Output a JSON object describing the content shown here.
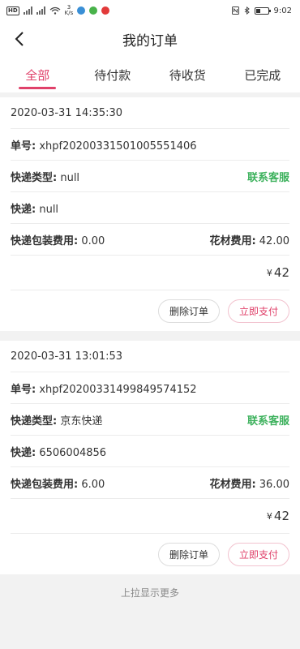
{
  "status_bar": {
    "network_badge": "HD",
    "speed_value": "3",
    "speed_unit": "K/s",
    "time": "9:02"
  },
  "header": {
    "title": "我的订单"
  },
  "tabs": [
    {
      "label": "全部",
      "active": true
    },
    {
      "label": "待付款",
      "active": false
    },
    {
      "label": "待收货",
      "active": false
    },
    {
      "label": "已完成",
      "active": false
    }
  ],
  "labels": {
    "order_no": "单号:",
    "express_type": "快递类型:",
    "express": "快递:",
    "pack_fee": "快递包装费用:",
    "flower_fee": "花材费用:",
    "contact_service": "联系客服",
    "currency": "¥",
    "delete_order": "删除订单",
    "pay_now": "立即支付"
  },
  "orders": [
    {
      "datetime": "2020-03-31 14:35:30",
      "order_no": "xhpf20200331501005551406",
      "express_type": "null",
      "express": "null",
      "pack_fee": "0.00",
      "flower_fee": "42.00",
      "total": "42"
    },
    {
      "datetime": "2020-03-31 13:01:53",
      "order_no": "xhpf20200331499849574152",
      "express_type": "京东快递",
      "express": "6506004856",
      "pack_fee": "6.00",
      "flower_fee": "36.00",
      "total": "42"
    }
  ],
  "footer": {
    "load_more": "上拉显示更多"
  },
  "colors": {
    "accent": "#e0416a",
    "service_green": "#3cb15c"
  }
}
